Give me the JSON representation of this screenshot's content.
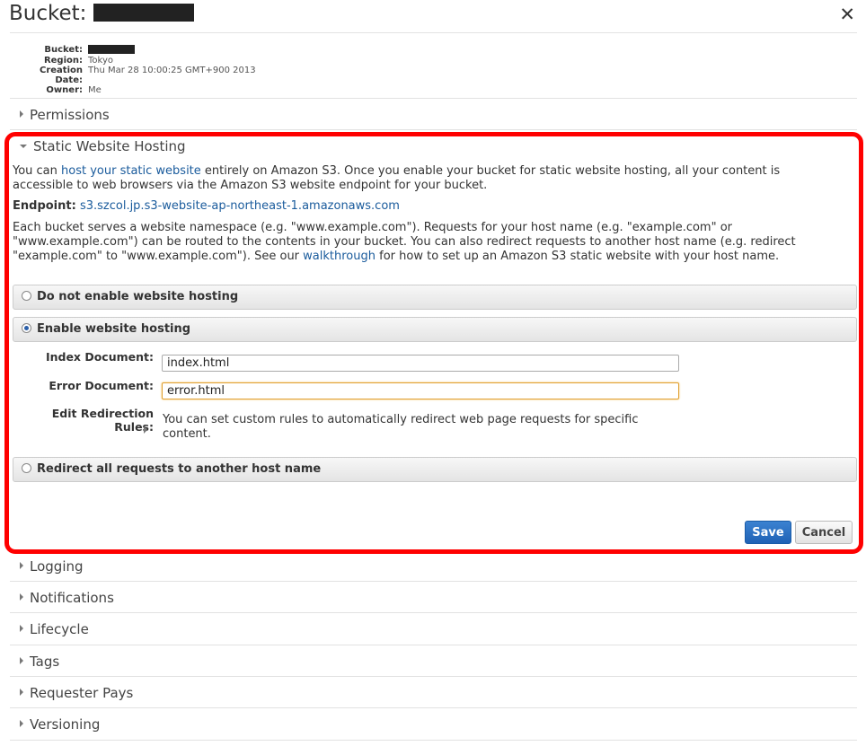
{
  "header": {
    "title": "Bucket:",
    "close_glyph": "✕"
  },
  "properties": {
    "bucket_label": "Bucket:",
    "region_label": "Region:",
    "region_value": "Tokyo",
    "creation_label": "Creation Date:",
    "creation_value": "Thu Mar 28 10:00:25 GMT+900 2013",
    "owner_label": "Owner:",
    "owner_value": "Me"
  },
  "sections": {
    "permissions": "Permissions",
    "static_website": "Static Website Hosting",
    "logging": "Logging",
    "notifications": "Notifications",
    "lifecycle": "Lifecycle",
    "tags": "Tags",
    "requester_pays": "Requester Pays",
    "versioning": "Versioning"
  },
  "hosting": {
    "intro_pre": "You can ",
    "intro_link": "host your static website",
    "intro_post": " entirely on Amazon S3. Once you enable your bucket for static website hosting, all your content is accessible to web browsers via the Amazon S3 website endpoint for your bucket.",
    "endpoint_label": "Endpoint:",
    "endpoint_value": "s3.szcol.jp.s3-website-ap-northeast-1.amazonaws.com",
    "namespace_pre": "Each bucket serves a website namespace (e.g. \"www.example.com\"). Requests for your host name (e.g. \"example.com\" or \"www.example.com\") can be routed to the contents in your bucket. You can also redirect requests to another host name (e.g. redirect \"example.com\" to \"www.example.com\"). See our ",
    "namespace_link": "walkthrough",
    "namespace_post": " for how to set up an Amazon S3 static website with your host name.",
    "option_disable": "Do not enable website hosting",
    "option_enable": "Enable website hosting",
    "option_redirect": "Redirect all requests to another host name",
    "index_label": "Index Document:",
    "index_value": "index.html",
    "error_label": "Error Document:",
    "error_value": "error.html",
    "redirect_rules_label": "Edit Redirection Rules:",
    "redirect_rules_text": "You can set custom rules to automatically redirect web page requests for specific content.",
    "save_label": "Save",
    "cancel_label": "Cancel"
  },
  "colors": {
    "highlight": "#ff0000",
    "link": "#1a5b9c",
    "primary_button": "#2a6fc2"
  },
  "icons": {
    "close": "close-icon",
    "collapsed": "triangle-right-icon",
    "expanded": "triangle-down-icon"
  }
}
